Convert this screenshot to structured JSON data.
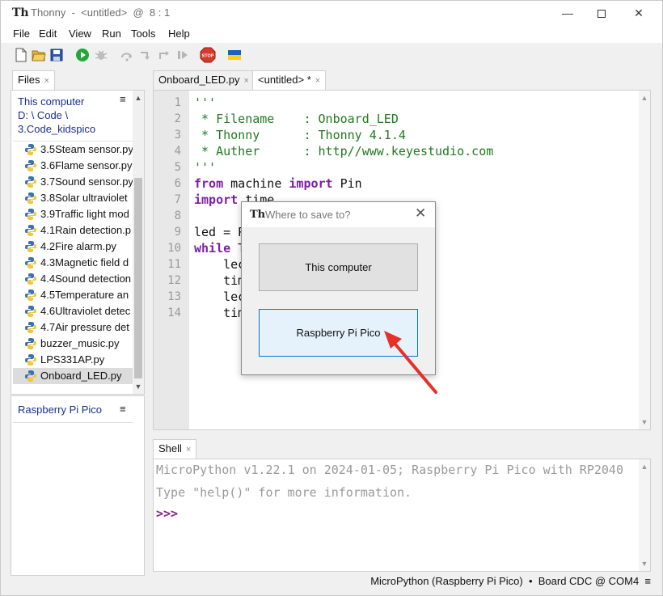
{
  "window": {
    "title": "Thonny  -  <untitled>  @  8 : 1",
    "controls": {
      "minimize": "—",
      "close": "✕"
    }
  },
  "menu": [
    "File",
    "Edit",
    "View",
    "Run",
    "Tools",
    "Help"
  ],
  "toolbar": {
    "icons": [
      "new-file-icon",
      "open-folder-icon",
      "save-icon",
      "run-icon",
      "debug-icon",
      "step-over-icon",
      "step-into-icon",
      "step-out-icon",
      "resume-icon",
      "stop-icon",
      "ukraine-flag-icon"
    ],
    "stop_label": "STOP"
  },
  "files_panel": {
    "tab_label": "Files",
    "path": "This computer\nD: \\ Code \\\n3.Code_kidspico",
    "files": [
      "3.5Steam sensor.py",
      "3.6Flame sensor.py",
      "3.7Sound sensor.py",
      "3.8Solar ultraviolet",
      "3.9Traffic light mod",
      "4.1Rain detection.p",
      "4.2Fire alarm.py",
      "4.3Magnetic field d",
      "4.4Sound detection",
      "4.5Temperature an",
      "4.6Ultraviolet detec",
      "4.7Air pressure det",
      "buzzer_music.py",
      "LPS331AP.py",
      "Onboard_LED.py"
    ],
    "selected_file": "Onboard_LED.py",
    "device_label": "Raspberry Pi Pico",
    "menu_glyph": "≡"
  },
  "editor": {
    "tabs": [
      {
        "label": "Onboard_LED.py",
        "close": "×"
      },
      {
        "label": "<untitled> *",
        "close": "×"
      }
    ],
    "line_numbers": [
      "1",
      "2",
      "3",
      "4",
      "5",
      "6",
      "7",
      "8",
      "9",
      "10",
      "11",
      "12",
      "13",
      "14"
    ],
    "lines": {
      "l1": "'''",
      "l2": " * Filename    : Onboard_LED",
      "l3": " * Thonny      : Thonny 4.1.4",
      "l4": " * Auther      : http//www.keyestudio.com",
      "l5": "'''",
      "l6_kw1": "from",
      "l6_mid": " machine ",
      "l6_kw2": "import",
      "l6_end": " Pin",
      "l7_kw": "import",
      "l7_end": " time",
      "l9": "led = P",
      "l10_kw": "while",
      "l10_end": " T",
      "l11": "    lec",
      "l12": "    tim",
      "l13": "    lec",
      "l14": "    tim"
    }
  },
  "shell": {
    "tab_label": "Shell",
    "close": "×",
    "line1": "MicroPython v1.22.1 on 2024-01-05; Raspberry Pi Pico with RP2040",
    "line2": "Type \"help()\" for more information.",
    "prompt": ">>>"
  },
  "status": {
    "text": "MicroPython (Raspberry Pi Pico)  •  Board CDC @ COM4  ≡"
  },
  "dialog": {
    "title": "Where to save to?",
    "close": "✕",
    "button_computer": "This computer",
    "button_pico": "Raspberry Pi Pico"
  },
  "colors": {
    "accent": "#0078d7",
    "annotation_arrow": "#e8302a",
    "path_text": "#1b2f8f",
    "string": "#1f7a1f",
    "keyword": "#7b1fa2"
  }
}
